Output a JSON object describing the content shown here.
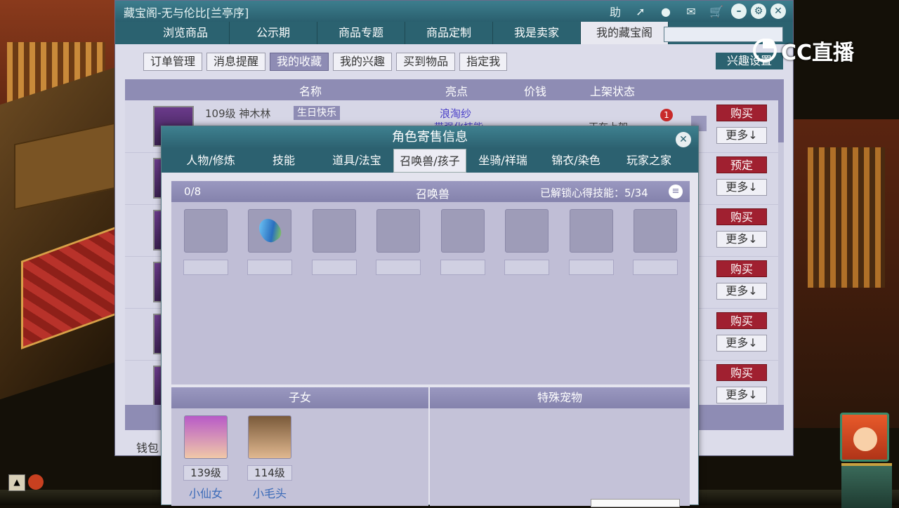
{
  "overlay_logo": {
    "text": "CC直播"
  },
  "window": {
    "title": "藏宝阁-无与伦比[兰亭序]",
    "title_icons": [
      "help-icon",
      "share-icon",
      "record-icon",
      "chat-icon",
      "cart-icon"
    ],
    "help_label": "助",
    "nav_tabs": [
      "浏览商品",
      "公示期",
      "商品专题",
      "商品定制",
      "我是卖家",
      "我的藏宝阁"
    ],
    "active_nav": "我的藏宝阁",
    "sub_tabs": [
      "订单管理",
      "消息提醒",
      "我的收藏",
      "我的兴趣",
      "买到物品",
      "指定我"
    ],
    "active_sub": "我的收藏",
    "interest_button": "兴趣设置",
    "table_headers": {
      "name": "名称",
      "highlight": "亮点",
      "price": "价钱",
      "status": "上架状态"
    },
    "rows": [
      {
        "level_name": "109级  神木林",
        "tag": "生日快乐",
        "highlight": "浪淘纱",
        "highlight2": "带强化技能",
        "status": "正在上架",
        "badge": "1",
        "action": "购买",
        "more": "更多↓"
      },
      {
        "action": "预定",
        "more": "更多↓"
      },
      {
        "action": "购买",
        "more": "更多↓"
      },
      {
        "action": "购买",
        "more": "更多↓"
      },
      {
        "action": "购买",
        "more": "更多↓"
      },
      {
        "action": "购买",
        "more": "更多↓"
      }
    ],
    "wallet_label": "钱包"
  },
  "dialog": {
    "title": "角色寄售信息",
    "tabs": [
      "人物/修炼",
      "技能",
      "道具/法宝",
      "召唤兽/孩子",
      "坐骑/祥瑞",
      "锦衣/染色",
      "玩家之家"
    ],
    "active_tab": "召唤兽/孩子",
    "pets": {
      "count": "0/8",
      "title": "召唤兽",
      "skills_label": "已解锁心得技能：",
      "skills_value": "5/34",
      "slots": [
        {
          "empty": true
        },
        {
          "empty": false,
          "icon": "gem-icon"
        },
        {
          "empty": true
        },
        {
          "empty": true
        },
        {
          "empty": true
        },
        {
          "empty": true
        },
        {
          "empty": true
        },
        {
          "empty": true
        }
      ]
    },
    "children": {
      "title": "子女",
      "items": [
        {
          "level": "139级",
          "name": "小仙女"
        },
        {
          "level": "114级",
          "name": "小毛头"
        }
      ]
    },
    "special_pets": {
      "title": "特殊宠物"
    }
  },
  "colors": {
    "teal_header": "#2c6170",
    "purple_header": "#8e8cb4",
    "buy_red": "#a02030",
    "child_name_blue": "#3a6ab8"
  }
}
